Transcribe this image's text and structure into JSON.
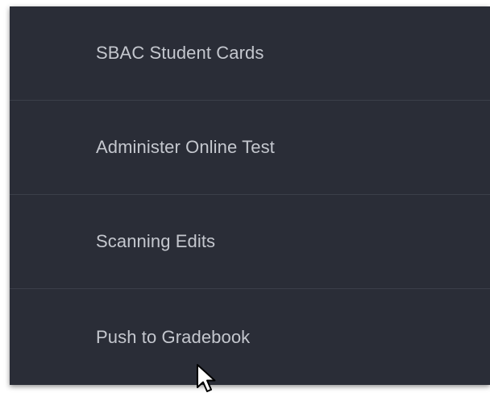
{
  "menu": {
    "items": [
      {
        "label": "SBAC Student Cards"
      },
      {
        "label": "Administer Online Test"
      },
      {
        "label": "Scanning Edits"
      },
      {
        "label": "Push to Gradebook"
      }
    ]
  },
  "cursor": {
    "icon": "mouse-pointer-icon"
  }
}
